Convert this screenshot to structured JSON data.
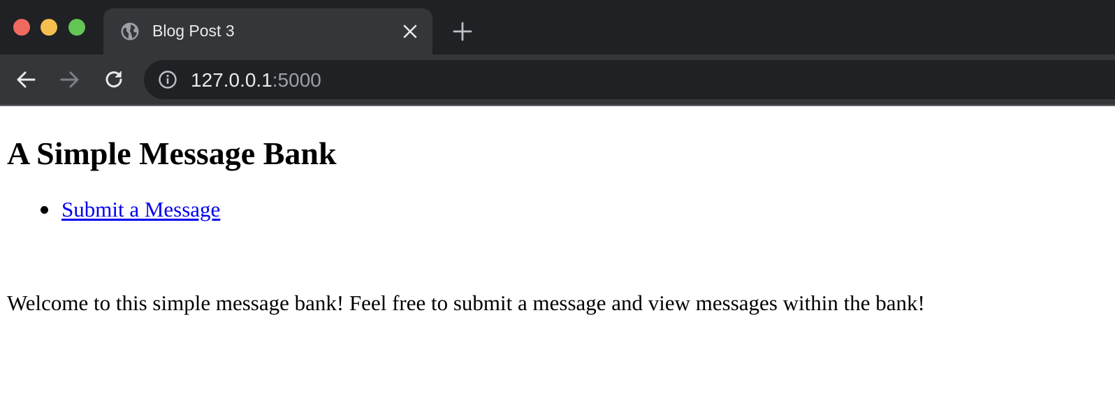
{
  "window": {
    "controls": {
      "close_color": "#ee6a5f",
      "minimize_color": "#f5bf4f",
      "maximize_color": "#62c554"
    }
  },
  "tabs": [
    {
      "title": "Blog Post 3",
      "icon": "globe-icon",
      "close_icon": "close-icon",
      "active": true
    }
  ],
  "toolbar": {
    "new_tab_icon": "plus-icon",
    "back_icon": "arrow-left-icon",
    "forward_icon": "arrow-right-icon",
    "reload_icon": "reload-icon",
    "forward_enabled": false
  },
  "address_bar": {
    "info_icon": "info-icon",
    "host": "127.0.0.1",
    "port": ":5000"
  },
  "page": {
    "heading": "A Simple Message Bank",
    "nav_links": [
      {
        "label": "Submit a Message"
      }
    ],
    "welcome_text": "Welcome to this simple message bank! Feel free to submit a message and view messages within the bank!"
  },
  "colors": {
    "chrome_dark": "#202124",
    "chrome_tab": "#35363a",
    "link": "#0000ee"
  }
}
